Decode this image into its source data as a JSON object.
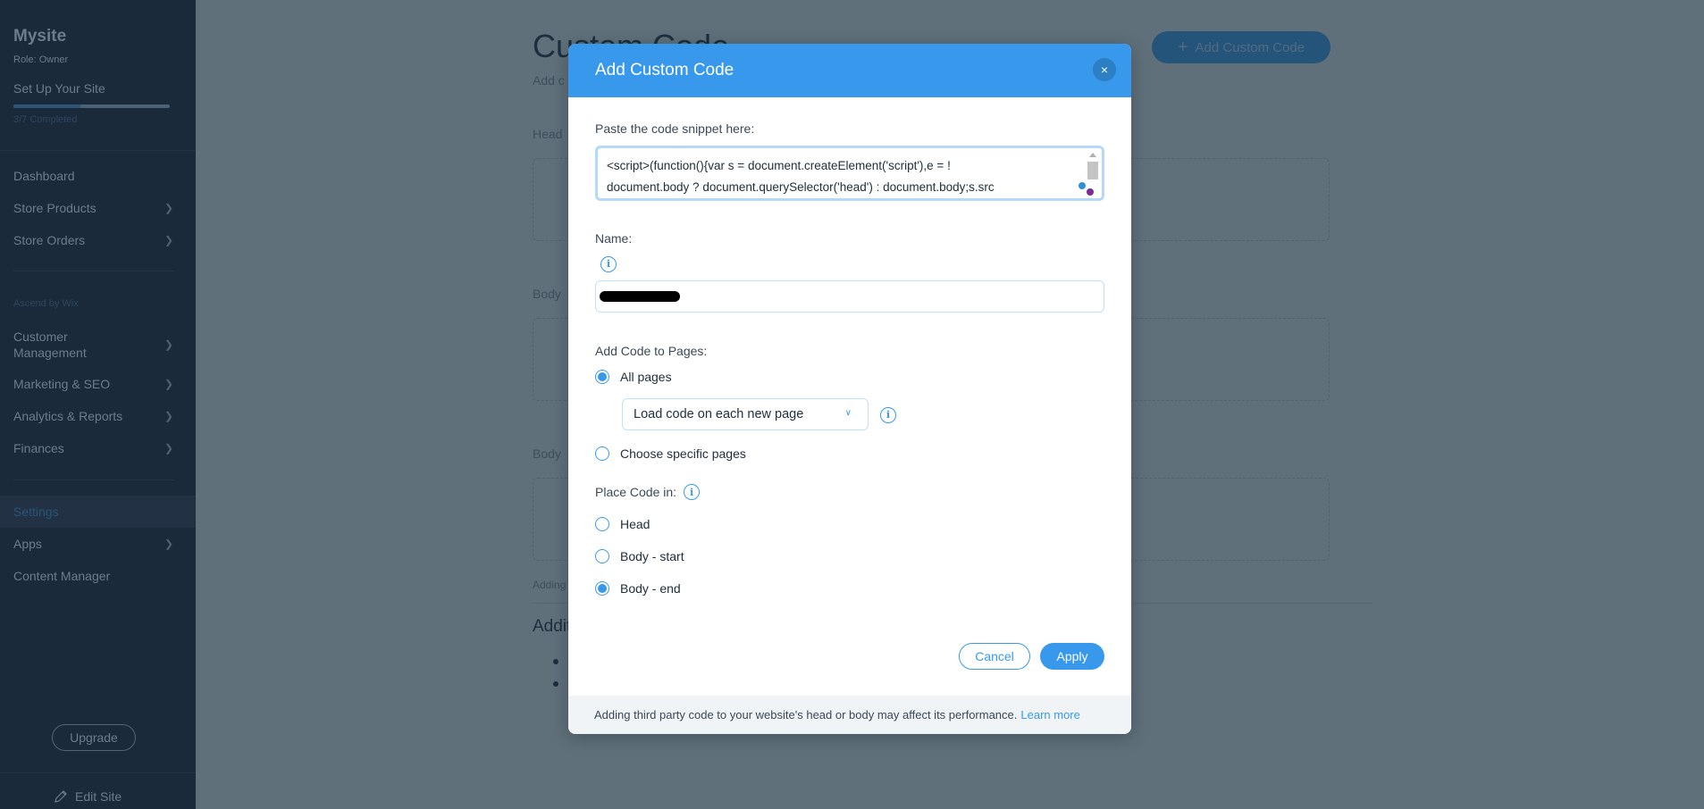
{
  "sidebar": {
    "site_name": "Mysite",
    "role": "Role: Owner",
    "setup_label": "Set Up Your Site",
    "setup_progress_fraction": 0.4286,
    "setup_completed": "3/7 Completed",
    "section_label": "Ascend by Wix",
    "items": [
      {
        "label": "Dashboard",
        "has_chevron": false
      },
      {
        "label": "Store Products",
        "has_chevron": true
      },
      {
        "label": "Store Orders",
        "has_chevron": true
      },
      {
        "label": "Customer Management",
        "has_chevron": true
      },
      {
        "label": "Marketing & SEO",
        "has_chevron": true
      },
      {
        "label": "Analytics & Reports",
        "has_chevron": true
      },
      {
        "label": "Finances",
        "has_chevron": true
      },
      {
        "label": "Settings",
        "has_chevron": false,
        "active": true
      },
      {
        "label": "Apps",
        "has_chevron": true
      },
      {
        "label": "Content Manager",
        "has_chevron": false
      }
    ],
    "customer_management_line1": "Customer",
    "customer_management_line2": "Management",
    "upgrade_label": "Upgrade",
    "edit_site_label": "Edit Site"
  },
  "background_page": {
    "title": "Custom Code",
    "subtitle": "Add c",
    "add_button_label": "Add Custom Code",
    "sections": [
      "Head",
      "Body",
      "Body"
    ],
    "note": "Adding",
    "additional_heading": "Addit"
  },
  "modal": {
    "title": "Add Custom Code",
    "close_icon": "×",
    "code_label": "Paste the code snippet here:",
    "code_lines": [
      "<script>(function(){var s = document.createElement('script'),e = !",
      "document.body ? document.querySelector('head') : document.body;s.src"
    ],
    "name_label": "Name:",
    "name_value_redacted": true,
    "pages_label": "Add Code to Pages:",
    "pages_options": [
      {
        "label": "All pages",
        "checked": true
      },
      {
        "label": "Choose specific pages",
        "checked": false
      }
    ],
    "load_select_value": "Load code on each new page",
    "place_label": "Place Code in:",
    "place_options": [
      {
        "label": "Head",
        "checked": false
      },
      {
        "label": "Body - start",
        "checked": false
      },
      {
        "label": "Body - end",
        "checked": true
      }
    ],
    "cancel_label": "Cancel",
    "apply_label": "Apply",
    "footer_text": "Adding third party code to your website's head or body may affect its performance.",
    "learn_more_label": "Learn more",
    "info_icon_glyph": "i",
    "accent_color": "#3899ec"
  }
}
